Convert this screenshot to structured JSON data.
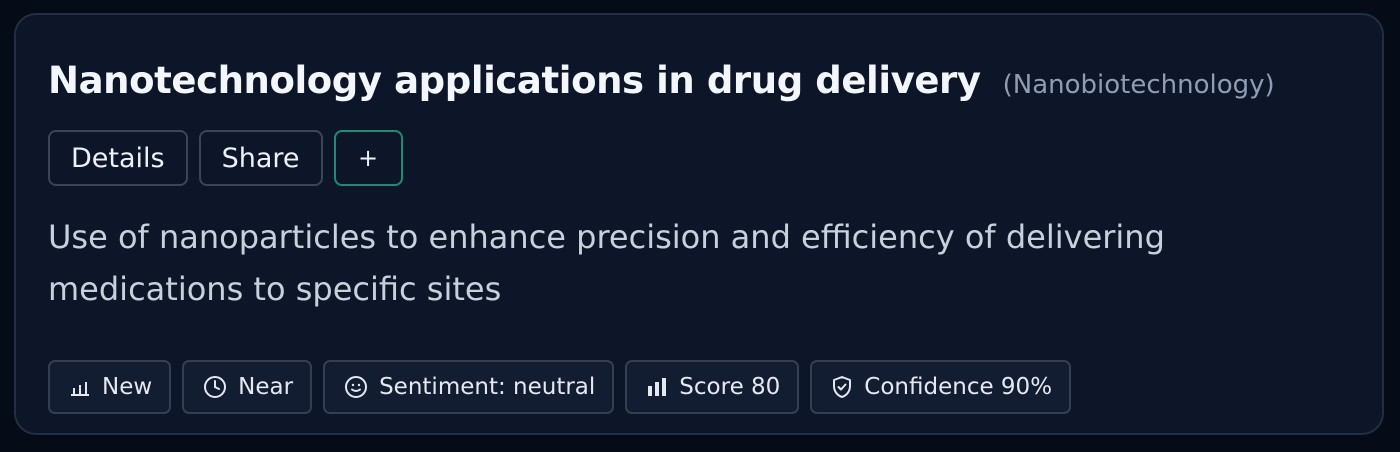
{
  "card": {
    "title": "Nanotechnology applications in drug delivery",
    "category": "(Nanobiotechnology)",
    "description": "Use of nanoparticles to enhance precision and efficiency of delivering medications to specific sites"
  },
  "actions": {
    "details_label": "Details",
    "share_label": "Share",
    "add_label": "+"
  },
  "chips": [
    {
      "icon": "bar-chart-low-icon",
      "label": "New"
    },
    {
      "icon": "clock-icon",
      "label": "Near"
    },
    {
      "icon": "smiley-icon",
      "label": "Sentiment: neutral"
    },
    {
      "icon": "bar-chart-icon",
      "label": "Score 80"
    },
    {
      "icon": "shield-check-icon",
      "label": "Confidence 90%"
    }
  ],
  "colors": {
    "background": "#060b18",
    "card": "#0d1628",
    "accent_border": "#1f8b75"
  }
}
